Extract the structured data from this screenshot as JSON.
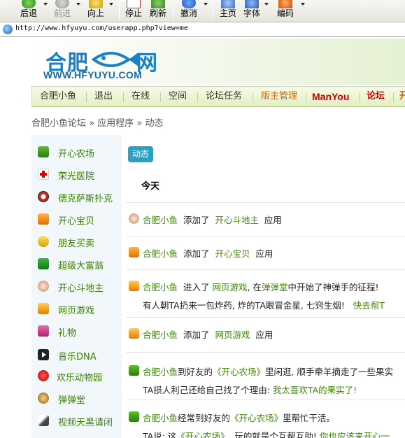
{
  "toolbar": {
    "back": "后退",
    "forward": "前进",
    "up": "向上",
    "stop": "停止",
    "refresh": "刷新",
    "undo": "撤消",
    "home": "主页",
    "font": "字体",
    "encoding": "编码"
  },
  "address": {
    "url": "http://www.hfyuyu.com/userapp.php?view=me"
  },
  "logo": {
    "cn_left": "合肥",
    "cn_right": "网",
    "en": "WWW.HFYUYU.COM"
  },
  "nav": {
    "items": [
      "合肥小鱼",
      "退出",
      "在线",
      "空间",
      "论坛任务",
      "版主管理",
      "ManYou",
      "论坛",
      "开"
    ]
  },
  "breadcrumb": {
    "root": "合肥小鱼论坛",
    "sep": "»",
    "apps": "应用程序",
    "current": "动态"
  },
  "sidebar": {
    "items": [
      {
        "label": "开心农场",
        "icon": "sprout-icon"
      },
      {
        "label": "荣光医院",
        "icon": "red-cross-icon"
      },
      {
        "label": "德克萨斯扑克",
        "icon": "poker-chip-icon"
      },
      {
        "label": "开心宝贝",
        "icon": "baby-icon"
      },
      {
        "label": "朋友买卖",
        "icon": "coins-icon"
      },
      {
        "label": "超级大富翁",
        "icon": "money-icon"
      },
      {
        "label": "开心斗地主",
        "icon": "cards-icon"
      },
      {
        "label": "网页游戏",
        "icon": "game-icon"
      },
      {
        "label": "礼物",
        "icon": "gift-icon"
      },
      {
        "label": "音乐DNA",
        "icon": "music-icon"
      },
      {
        "label": "欢乐动物园",
        "icon": "animal-icon"
      },
      {
        "label": "弹弹堂",
        "icon": "ddt-icon"
      },
      {
        "label": "视频天黑请闭",
        "icon": "video-icon"
      }
    ]
  },
  "main": {
    "tab": "动态",
    "today": "今天",
    "feed": [
      {
        "user": "合肥小鱼",
        "text1": "添加了",
        "app": "开心斗地主",
        "text2": "应用"
      },
      {
        "user": "合肥小鱼",
        "text1": "添加了",
        "app": "开心宝贝",
        "text2": "应用"
      },
      {
        "user": "合肥小鱼",
        "text1": "进入了",
        "app": "网页游戏",
        "text2": ", 在",
        "app2": "弹弹堂",
        "text3": "中开始了神弹手的征程!",
        "sub1": "有人朝TA扔来一包炸药, 炸的TA眼冒金星, 七窍生烟!",
        "sub2": "快去帮T"
      },
      {
        "user": "合肥小鱼",
        "text1": "添加了",
        "app": "网页游戏",
        "text2": "应用"
      },
      {
        "user": "合肥小鱼",
        "text1": "到好友的",
        "app": "《开心农场》",
        "text2": "里闲逛, 顺手牵羊摘走了一些果实",
        "sub1": "TA损人利己还给自己找了个理由:",
        "sub2": "我太喜欢TA的果实了!"
      },
      {
        "user": "合肥小鱼",
        "text1": "经常到好友的",
        "app": "《开心农场》",
        "text2": "里帮忙干活。",
        "sub1": "TA说: 这",
        "sub_app": "《开心农场》",
        "sub_mid": ", 玩的就是个互帮互助!",
        "sub2": "你也应该来开心一"
      }
    ]
  },
  "colors": {
    "link_green": "#3c8c00",
    "brand_blue": "#1d7fc4",
    "tab_blue": "#2aa0c8",
    "nav_orange": "#e06000",
    "nav_red": "#cc0000"
  }
}
